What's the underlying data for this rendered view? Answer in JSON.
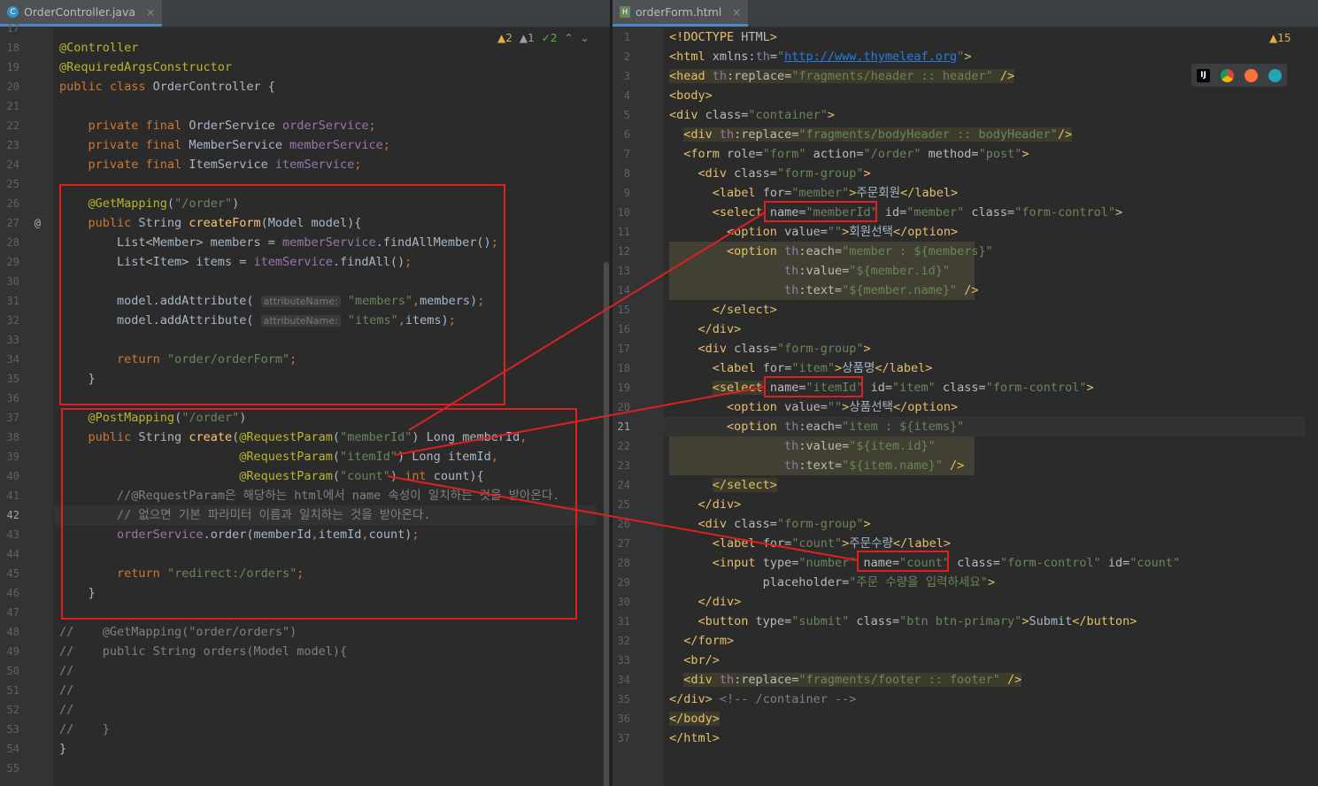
{
  "left_tab": {
    "title": "OrderController.java",
    "close": "×",
    "icon": "C"
  },
  "right_tab": {
    "title": "orderForm.html",
    "close": "×",
    "icon": "H"
  },
  "left_indicators": {
    "warnings": "2",
    "weak": "1",
    "ok": "2"
  },
  "right_indicators": {
    "warnings": "15"
  },
  "browser_icons": [
    "intellij-icon",
    "chrome-icon",
    "firefox-icon",
    "edge-icon"
  ],
  "left_lines": [
    {
      "n": "17",
      "html": ""
    },
    {
      "n": "18",
      "html": "<span class='ann'>@Controller</span>"
    },
    {
      "n": "19",
      "html": "<span class='ann'>@RequiredArgsConstructor</span>"
    },
    {
      "n": "20",
      "html": "<span class='kw'>public class </span>OrderController {"
    },
    {
      "n": "21",
      "html": ""
    },
    {
      "n": "22",
      "html": "    <span class='kw'>private final </span>OrderService <span class='fld'>orderService</span><span class='kw'>;</span>"
    },
    {
      "n": "23",
      "html": "    <span class='kw'>private final </span>MemberService <span class='fld'>memberService</span><span class='kw'>;</span>"
    },
    {
      "n": "24",
      "html": "    <span class='kw'>private final </span>ItemService <span class='fld'>itemService</span><span class='kw'>;</span>"
    },
    {
      "n": "25",
      "html": ""
    },
    {
      "n": "26",
      "html": "    <span class='ann'>@GetMapping</span>(<span class='str'>\"/order\"</span>)"
    },
    {
      "n": "27",
      "html": "    <span class='kw'>public </span>String <span class='fn'>createForm</span>(Model model){"
    },
    {
      "n": "28",
      "html": "        List&lt;Member&gt; members = <span class='fld'>memberService</span>.findAllMember()<span class='kw'>;</span>"
    },
    {
      "n": "29",
      "html": "        List&lt;Item&gt; items = <span class='fld'>itemService</span>.findAll()<span class='kw'>;</span>"
    },
    {
      "n": "30",
      "html": ""
    },
    {
      "n": "31",
      "html": "        model.addAttribute( <span class='hint'>attributeName:</span> <span class='str'>\"members\"</span><span class='kw'>,</span>members)<span class='kw'>;</span>"
    },
    {
      "n": "32",
      "html": "        model.addAttribute( <span class='hint'>attributeName:</span> <span class='str'>\"items\"</span><span class='kw'>,</span>items)<span class='kw'>;</span>"
    },
    {
      "n": "33",
      "html": ""
    },
    {
      "n": "34",
      "html": "        <span class='kw'>return </span><span class='str'>\"order/orderForm\"</span><span class='kw'>;</span>"
    },
    {
      "n": "35",
      "html": "    }"
    },
    {
      "n": "36",
      "html": ""
    },
    {
      "n": "37",
      "html": "    <span class='ann'>@PostMapping</span>(<span class='str'>\"/order\"</span>)"
    },
    {
      "n": "38",
      "html": "    <span class='kw'>public </span>String <span class='fn'>create</span>(<span class='ann'>@RequestParam</span>(<span class='str'>\"memberId\"</span>) Long memberId<span class='kw'>,</span>"
    },
    {
      "n": "39",
      "html": "                         <span class='ann'>@RequestParam</span>(<span class='str'>\"itemId\"</span>) Long itemId<span class='kw'>,</span>"
    },
    {
      "n": "40",
      "html": "                         <span class='ann'>@RequestParam</span>(<span class='str'>\"count\"</span>) <span class='kw'>int </span>count){"
    },
    {
      "n": "41",
      "html": "        <span class='cmt'>//@RequestParam은 해당하는 html에서 name 속성이 일치하는 것을 받아온다.</span>"
    },
    {
      "n": "42",
      "html": "        <span class='cmt'>// 없으면 기본 파라미터 이름과 일치하는 것을 받아온다.</span>"
    },
    {
      "n": "43",
      "html": "        <span class='fld'>orderService</span>.order(memberId<span class='kw'>,</span>itemId<span class='kw'>,</span>count)<span class='kw'>;</span>"
    },
    {
      "n": "44",
      "html": ""
    },
    {
      "n": "45",
      "html": "        <span class='kw'>return </span><span class='str'>\"redirect:/orders\"</span><span class='kw'>;</span>"
    },
    {
      "n": "46",
      "html": "    }"
    },
    {
      "n": "47",
      "html": ""
    },
    {
      "n": "48",
      "html": "<span class='cmt'>//    @GetMapping(\"order/orders\")</span>"
    },
    {
      "n": "49",
      "html": "<span class='cmt'>//    public String orders(Model model){</span>"
    },
    {
      "n": "50",
      "html": "<span class='cmt'>//</span>"
    },
    {
      "n": "51",
      "html": "<span class='cmt'>//</span>"
    },
    {
      "n": "52",
      "html": "<span class='cmt'>//</span>"
    },
    {
      "n": "53",
      "html": "<span class='cmt'>//    }</span>"
    },
    {
      "n": "54",
      "html": "}"
    },
    {
      "n": "55",
      "html": ""
    }
  ],
  "right_lines": [
    {
      "n": "1",
      "html": "<span class='tag'>&lt;!DOCTYPE </span><span class='attr'>HTML</span><span class='tag'>&gt;</span>"
    },
    {
      "n": "2",
      "html": "<span class='tag'>&lt;html </span><span class='attr'>xmlns:</span><span class='ns'>th</span><span class='attr'>=</span><span class='aval'>\"<span class='url'>http://www.thymeleaf.org</span>\"</span><span class='tag'>&gt;</span>"
    },
    {
      "n": "3",
      "html": "<span class='hl'><span class='tag'>&lt;head </span><span class='ns'>th</span><span class='attr'>:replace=</span><span class='aval'>\"fragments/header :: header\"</span> <span class='tag'>/&gt;</span></span>"
    },
    {
      "n": "4",
      "html": "<span class='tag'>&lt;body&gt;</span>"
    },
    {
      "n": "5",
      "html": "<span class='tag'>&lt;div </span><span class='attr'>class=</span><span class='aval'>\"container\"</span><span class='tag'>&gt;</span>"
    },
    {
      "n": "6",
      "html": "  <span class='hl'><span class='tag'>&lt;div </span><span class='ns'>th</span><span class='attr'>:replace=</span><span class='aval'>\"fragments/bodyHeader :: bodyHeader\"</span><span class='tag'>/&gt;</span></span>"
    },
    {
      "n": "7",
      "html": "  <span class='tag'>&lt;form </span><span class='attr'>role=</span><span class='aval'>\"form\" </span><span class='attr'>action=</span><span class='aval'>\"/order\" </span><span class='attr'>method=</span><span class='aval'>\"post\"</span><span class='tag'>&gt;</span>"
    },
    {
      "n": "8",
      "html": "    <span class='tag'>&lt;div </span><span class='attr'>class=</span><span class='aval'>\"form-group\"</span><span class='tag'>&gt;</span>"
    },
    {
      "n": "9",
      "html": "      <span class='tag'>&lt;label </span><span class='attr'>for=</span><span class='aval'>\"member\"</span><span class='tag'>&gt;</span>주문회원<span class='tag'>&lt;/label&gt;</span>"
    },
    {
      "n": "10",
      "html": "      <span class='tag'>&lt;select </span><span class='attr'>name=</span><span class='aval'>\"memberId\" </span><span class='attr'>id=</span><span class='aval'>\"member\" </span><span class='attr'>class=</span><span class='aval'>\"form-control\"</span><span class='tag'>&gt;</span>"
    },
    {
      "n": "11",
      "html": "        <span class='tag'>&lt;option </span><span class='attr'>value=</span><span class='aval'>\"\"</span><span class='tag'>&gt;</span>회원선택<span class='tag'>&lt;/option&gt;</span>"
    },
    {
      "n": "12",
      "html": "        <span class='tag'>&lt;option </span><span class='ns'>th</span><span class='attr'>:each=</span><span class='aval'>\"member : ${members}\"</span>"
    },
    {
      "n": "13",
      "html": "                <span class='ns'>th</span><span class='attr'>:value=</span><span class='aval'>\"${member.id}\"</span>"
    },
    {
      "n": "14",
      "html": "                <span class='ns'>th</span><span class='attr'>:text=</span><span class='aval'>\"${member.name}\"</span> <span class='tag'>/&gt;</span>"
    },
    {
      "n": "15",
      "html": "      <span class='tag'>&lt;/select&gt;</span>"
    },
    {
      "n": "16",
      "html": "    <span class='tag'>&lt;/div&gt;</span>"
    },
    {
      "n": "17",
      "html": "    <span class='tag'>&lt;div </span><span class='attr'>class=</span><span class='aval'>\"form-group\"</span><span class='tag'>&gt;</span>"
    },
    {
      "n": "18",
      "html": "      <span class='tag'>&lt;label </span><span class='attr'>for=</span><span class='aval'>\"item\"</span><span class='tag'>&gt;</span>상품명<span class='tag'>&lt;/label&gt;</span>"
    },
    {
      "n": "19",
      "html": "      <span class='hl'><span class='tag'>&lt;select</span></span> <span class='attr'>name=</span><span class='aval'>\"itemId\" </span><span class='attr'>id=</span><span class='aval'>\"item\" </span><span class='attr'>class=</span><span class='aval'>\"form-control\"</span><span class='tag'>&gt;</span>"
    },
    {
      "n": "20",
      "html": "        <span class='tag'>&lt;option </span><span class='attr'>value=</span><span class='aval'>\"\"</span><span class='tag'>&gt;</span>상품선택<span class='tag'>&lt;/option&gt;</span>"
    },
    {
      "n": "21",
      "html": "        <span class='tag'>&lt;option </span><span class='ns'>th</span><span class='attr'>:each=</span><span class='aval'>\"item : ${items}\"</span>"
    },
    {
      "n": "22",
      "html": "                <span class='ns'>th</span><span class='attr'>:value=</span><span class='aval'>\"${item.id}\"</span>"
    },
    {
      "n": "23",
      "html": "                <span class='ns'>th</span><span class='attr'>:text=</span><span class='aval'>\"${item.name}\"</span> <span class='tag'>/&gt;</span>"
    },
    {
      "n": "24",
      "html": "      <span class='hl'><span class='tag'>&lt;/select&gt;</span></span>"
    },
    {
      "n": "25",
      "html": "    <span class='tag'>&lt;/div&gt;</span>"
    },
    {
      "n": "26",
      "html": "    <span class='tag'>&lt;div </span><span class='attr'>class=</span><span class='aval'>\"form-group\"</span><span class='tag'>&gt;</span>"
    },
    {
      "n": "27",
      "html": "      <span class='tag'>&lt;label </span><span class='attr'>for=</span><span class='aval'>\"count\"</span><span class='tag'>&gt;</span>주문수량<span class='tag'>&lt;/label&gt;</span>"
    },
    {
      "n": "28",
      "html": "      <span class='tag'>&lt;input </span><span class='attr'>type=</span><span class='aval'>\"number\" </span><span class='attr'>name=</span><span class='aval'>\"count\" </span><span class='attr'>class=</span><span class='aval'>\"form-control\" </span><span class='attr'>id=</span><span class='aval'>\"count\"</span>"
    },
    {
      "n": "29",
      "html": "             <span class='attr'>placeholder=</span><span class='aval'>\"주문 수량을 입력하세요\"</span><span class='tag'>&gt;</span>"
    },
    {
      "n": "30",
      "html": "    <span class='tag'>&lt;/div&gt;</span>"
    },
    {
      "n": "31",
      "html": "    <span class='tag'>&lt;button </span><span class='attr'>type=</span><span class='aval'>\"submit\" </span><span class='attr'>class=</span><span class='aval'>\"btn btn-primary\"</span><span class='tag'>&gt;</span>Submit<span class='tag'>&lt;/button&gt;</span>"
    },
    {
      "n": "32",
      "html": "  <span class='tag'>&lt;/form&gt;</span>"
    },
    {
      "n": "33",
      "html": "  <span class='tag'>&lt;br/&gt;</span>"
    },
    {
      "n": "34",
      "html": "  <span class='hl'><span class='tag'>&lt;div </span><span class='ns'>th</span><span class='attr'>:replace=</span><span class='aval'>\"fragments/footer :: footer\"</span> <span class='tag'>/&gt;</span></span>"
    },
    {
      "n": "35",
      "html": "<span class='tag'>&lt;/div&gt;</span> <span class='cmt'>&lt;!-- /container --&gt;</span>"
    },
    {
      "n": "36",
      "html": "<span class='hl'><span class='tag'>&lt;/body&gt;</span></span>"
    },
    {
      "n": "37",
      "html": "<span class='tag'>&lt;/html&gt;</span>"
    }
  ],
  "left_current_line": "42",
  "right_current_line": "21",
  "annotation_color": "#e02020"
}
